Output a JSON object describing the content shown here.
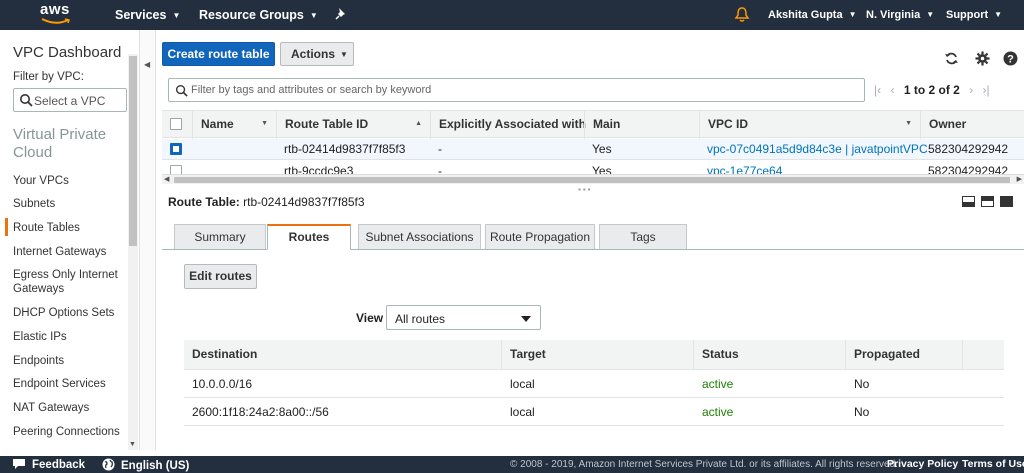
{
  "topbar": {
    "logo": "aws",
    "services": "Services",
    "resource_groups": "Resource Groups",
    "user": "Akshita Gupta",
    "region": "N. Virginia",
    "support": "Support"
  },
  "sidebar": {
    "title": "VPC Dashboard",
    "filter_label": "Filter by VPC:",
    "filter_placeholder": "Select a VPC",
    "section_heading": "Virtual Private Cloud",
    "items": [
      {
        "label": "Your VPCs"
      },
      {
        "label": "Subnets"
      },
      {
        "label": "Route Tables"
      },
      {
        "label": "Internet Gateways"
      },
      {
        "label": "Egress Only Internet Gateways"
      },
      {
        "label": "DHCP Options Sets"
      },
      {
        "label": "Elastic IPs"
      },
      {
        "label": "Endpoints"
      },
      {
        "label": "Endpoint Services"
      },
      {
        "label": "NAT Gateways"
      },
      {
        "label": "Peering Connections"
      }
    ],
    "active_item": "Route Tables"
  },
  "toolbar": {
    "create_label": "Create route table",
    "actions_label": "Actions"
  },
  "search": {
    "placeholder": "Filter by tags and attributes or search by keyword"
  },
  "pager": {
    "label": "1 to 2 of 2"
  },
  "route_tables": {
    "columns": [
      "Name",
      "Route Table ID",
      "Explicitly Associated with",
      "Main",
      "VPC ID",
      "Owner"
    ],
    "rows": [
      {
        "name": "",
        "id": "rtb-02414d9837f7f85f3",
        "explicit": "-",
        "main": "Yes",
        "vpc": "vpc-07c0491a5d9d84c3e | javatpointVPC",
        "owner": "582304292942",
        "selected": true
      },
      {
        "name": "",
        "id": "rtb-9ccdc9e3",
        "explicit": "-",
        "main": "Yes",
        "vpc": "vpc-1e77ce64",
        "owner": "582304292942",
        "selected": false
      }
    ]
  },
  "detail": {
    "label": "Route Table:",
    "value": "rtb-02414d9837f7f85f3",
    "tabs": [
      "Summary",
      "Routes",
      "Subnet Associations",
      "Route Propagation",
      "Tags"
    ],
    "active_tab": "Routes",
    "edit_label": "Edit routes",
    "view_label": "View",
    "view_value": "All routes",
    "routes": {
      "columns": [
        "Destination",
        "Target",
        "Status",
        "Propagated"
      ],
      "rows": [
        {
          "destination": "10.0.0.0/16",
          "target": "local",
          "status": "active",
          "propagated": "No"
        },
        {
          "destination": "2600:1f18:24a2:8a00::/56",
          "target": "local",
          "status": "active",
          "propagated": "No"
        }
      ]
    }
  },
  "footer": {
    "feedback": "Feedback",
    "language": "English (US)",
    "copyright": "© 2008 - 2019, Amazon Internet Services Private Ltd. or its affiliates. All rights reserved.",
    "privacy": "Privacy Policy",
    "terms": "Terms of Use"
  },
  "colors": {
    "nav_bg": "#232f3e",
    "primary": "#1166bb",
    "accent": "#ec7211",
    "link": "#0073bb",
    "status_active": "#1d8102"
  }
}
